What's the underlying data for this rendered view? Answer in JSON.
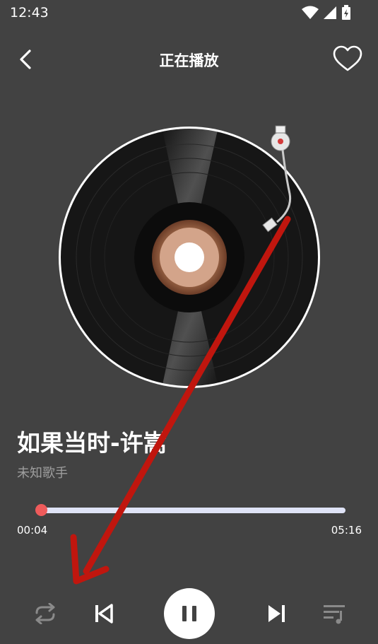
{
  "status_bar": {
    "time": "12:43",
    "icons": [
      "wifi-icon",
      "signal-icon",
      "battery-icon"
    ]
  },
  "header": {
    "title": "正在播放",
    "back_icon": "back-arrow-icon",
    "favorite_icon": "heart-outline-icon"
  },
  "song": {
    "title": "如果当时-许嵩",
    "artist": "未知歌手"
  },
  "progress": {
    "current": "00:04",
    "total": "05:16",
    "fraction": 0.013
  },
  "controls": {
    "repeat_icon": "repeat-icon",
    "previous_icon": "skip-previous-icon",
    "play_pause_icon": "pause-icon",
    "next_icon": "skip-next-icon",
    "playlist_icon": "playlist-icon"
  },
  "colors": {
    "background": "#424242",
    "accent": "#ef5b5b",
    "track": "#dfe3f6",
    "annotation": "#c0160e"
  }
}
